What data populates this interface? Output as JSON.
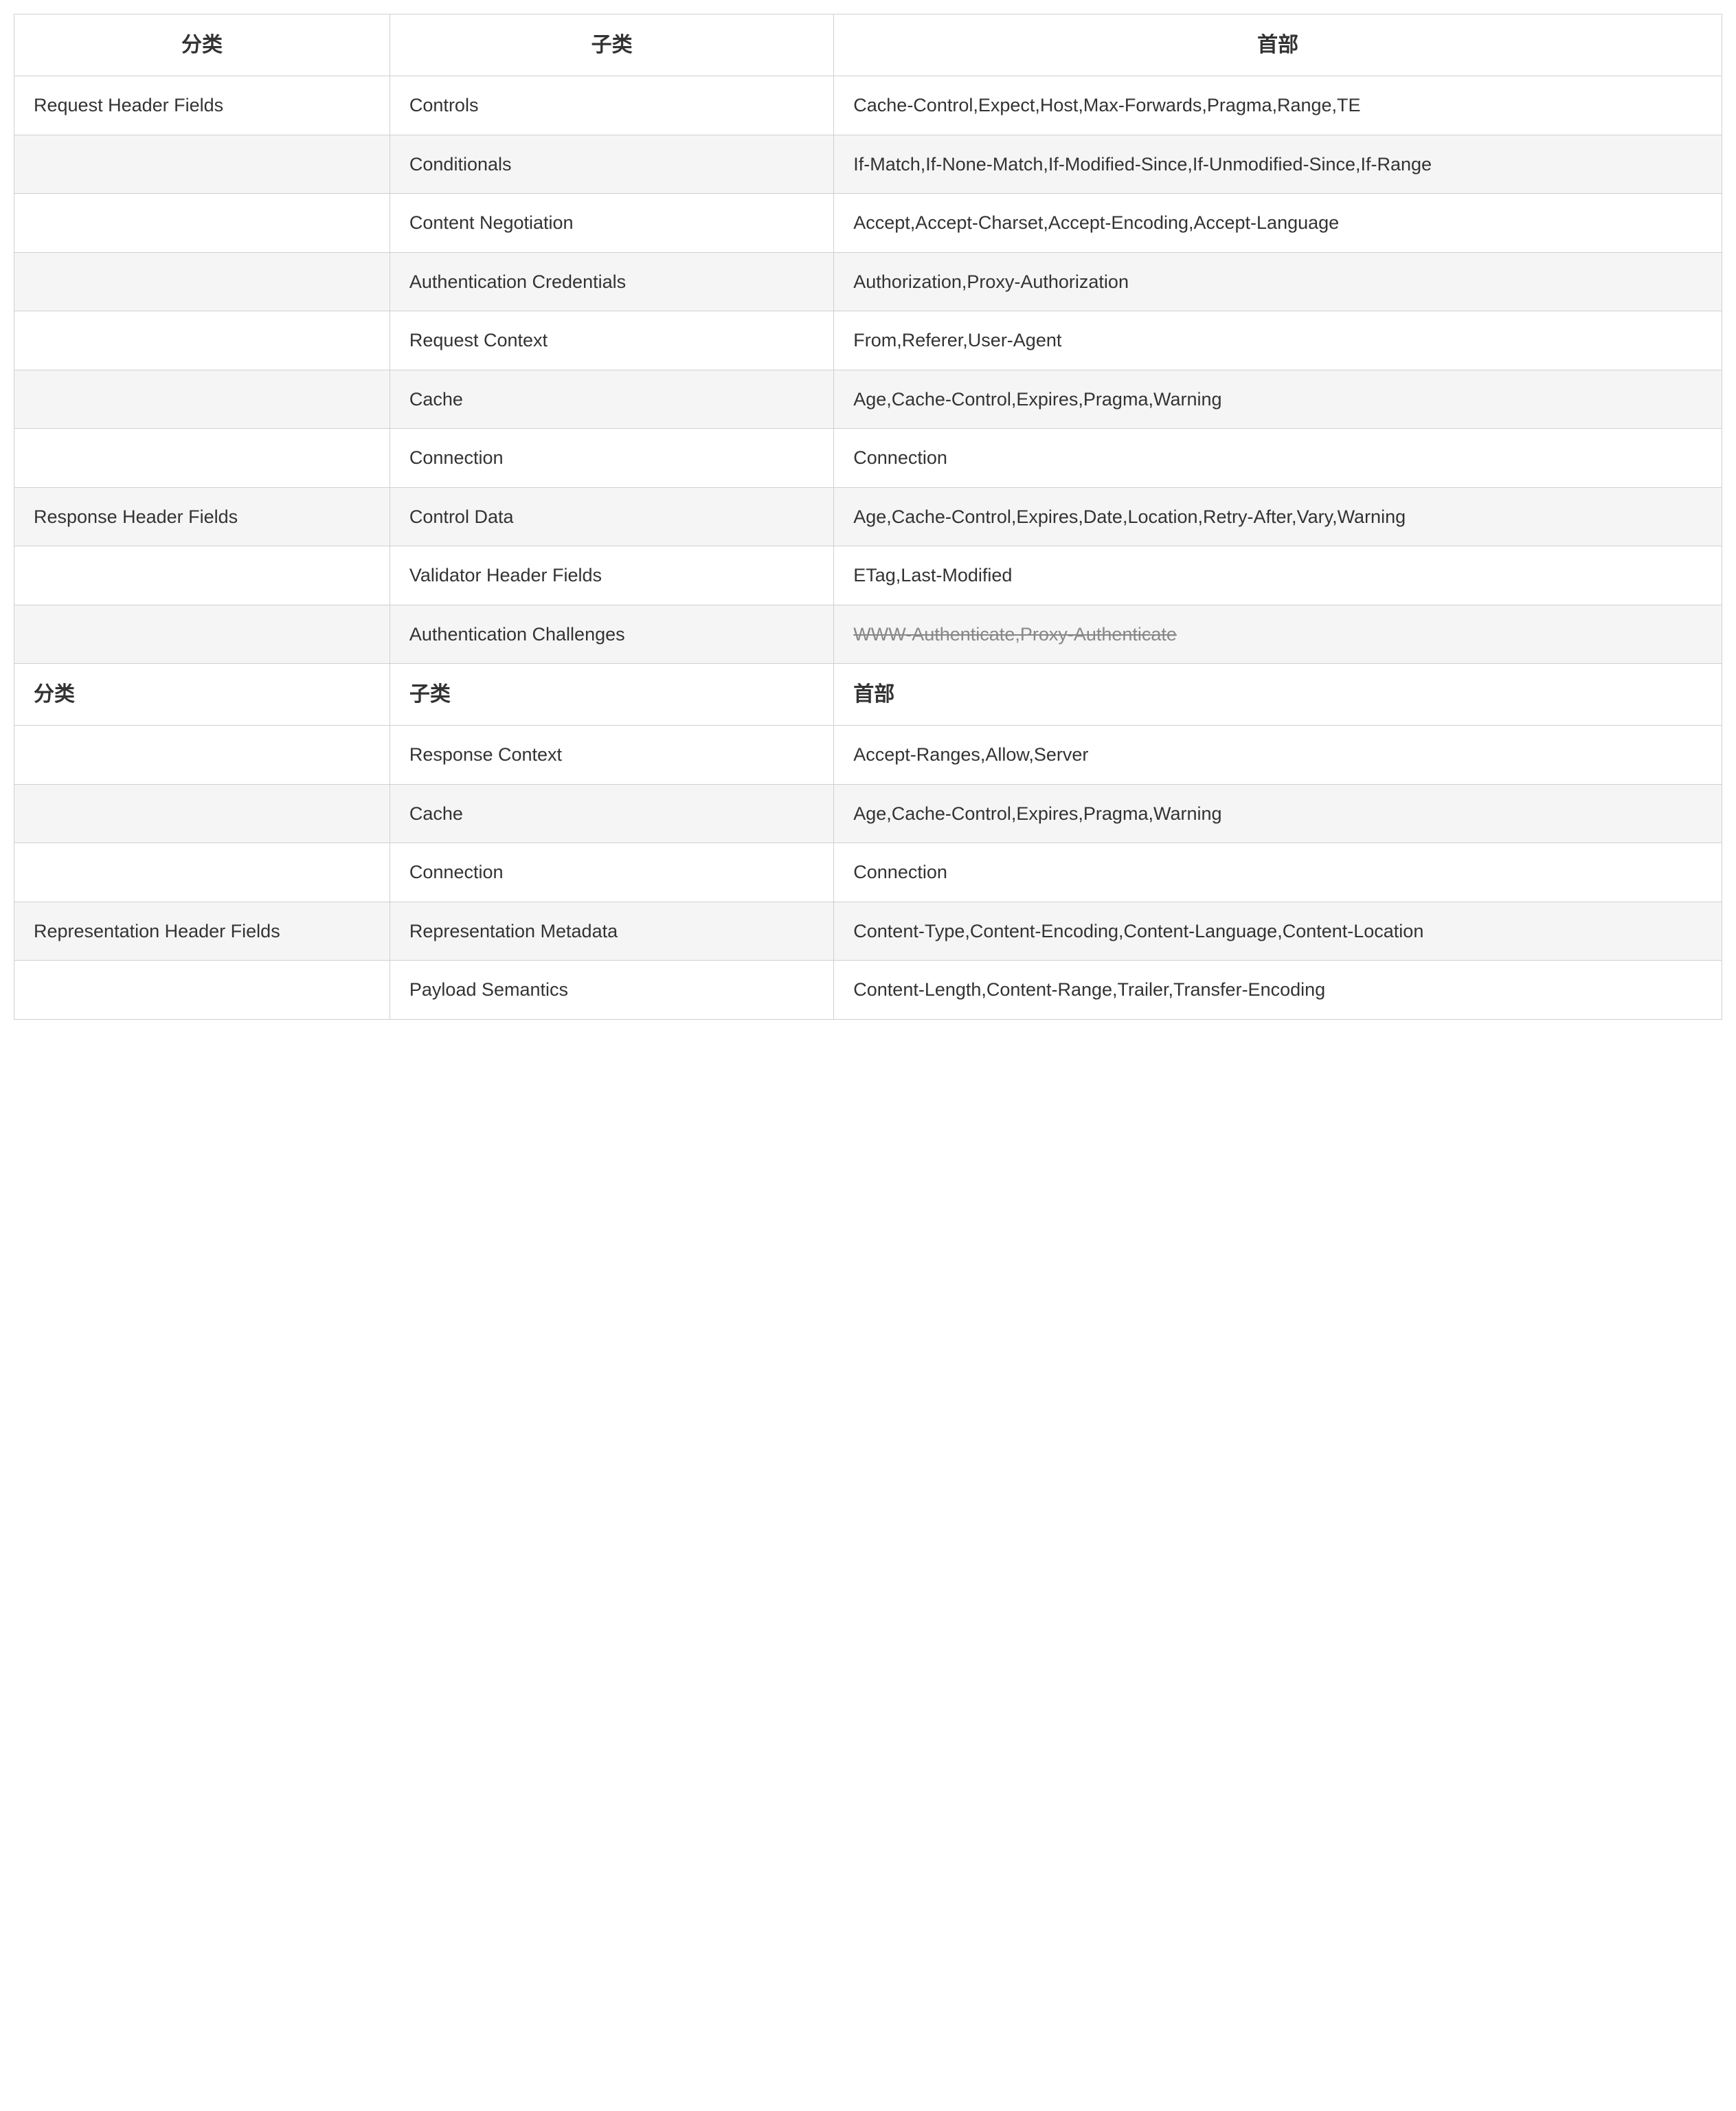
{
  "table": {
    "headers": [
      "分类",
      "子类",
      "首部"
    ],
    "rows": [
      {
        "category": "Request Header Fields",
        "subcategory": "Controls",
        "headers_value": "Cache-Control,Expect,Host,Max-Forwards,Pragma,Range,TE",
        "shaded": false,
        "show_category": true
      },
      {
        "category": "",
        "subcategory": "Conditionals",
        "headers_value": "If-Match,If-None-Match,If-Modified-Since,If-Unmodified-Since,If-Range",
        "shaded": true,
        "show_category": false
      },
      {
        "category": "",
        "subcategory": "Content Negotiation",
        "headers_value": "Accept,Accept-Charset,Accept-Encoding,Accept-Language",
        "shaded": false,
        "show_category": false
      },
      {
        "category": "",
        "subcategory": "Authentication Credentials",
        "headers_value": "Authorization,Proxy-Authorization",
        "shaded": true,
        "show_category": false
      },
      {
        "category": "",
        "subcategory": "Request Context",
        "headers_value": "From,Referer,User-Agent",
        "shaded": false,
        "show_category": false
      },
      {
        "category": "",
        "subcategory": "Cache",
        "headers_value": "Age,Cache-Control,Expires,Pragma,Warning",
        "shaded": true,
        "show_category": false
      },
      {
        "category": "",
        "subcategory": "Connection",
        "headers_value": "Connection",
        "shaded": false,
        "show_category": false
      },
      {
        "category": "Response Header Fields",
        "subcategory": "Control Data",
        "headers_value": "Age,Cache-Control,Expires,Date,Location,Retry-After,Vary,Warning",
        "shaded": true,
        "show_category": true
      },
      {
        "category": "",
        "subcategory": "Validator Header Fields",
        "headers_value": "ETag,Last-Modified",
        "shaded": false,
        "show_category": false
      },
      {
        "category": "",
        "subcategory": "Authentication Challenges",
        "headers_value": "WWW-Authenticate,Proxy-Authenticate",
        "shaded": true,
        "show_category": false,
        "is_overlap": true
      },
      {
        "category": "",
        "subcategory": "Response Context",
        "headers_value": "Accept-Ranges,Allow,Server",
        "shaded": false,
        "show_category": false
      },
      {
        "category": "",
        "subcategory": "Cache",
        "headers_value": "Age,Cache-Control,Expires,Pragma,Warning",
        "shaded": true,
        "show_category": false
      },
      {
        "category": "",
        "subcategory": "Connection",
        "headers_value": "Connection",
        "shaded": false,
        "show_category": false
      },
      {
        "category": "Representation Header Fields",
        "subcategory": "Representation Metadata",
        "headers_value": "Content-Type,Content-Encoding,Content-Language,Content-Location",
        "shaded": true,
        "show_category": true
      },
      {
        "category": "",
        "subcategory": "Payload Semantics",
        "headers_value": "Content-Length,Content-Range,Trailer,Transfer-Encoding",
        "shaded": false,
        "show_category": false
      }
    ],
    "sticky_row": {
      "col1": "分类",
      "col2": "子类",
      "col3": "首部"
    }
  }
}
